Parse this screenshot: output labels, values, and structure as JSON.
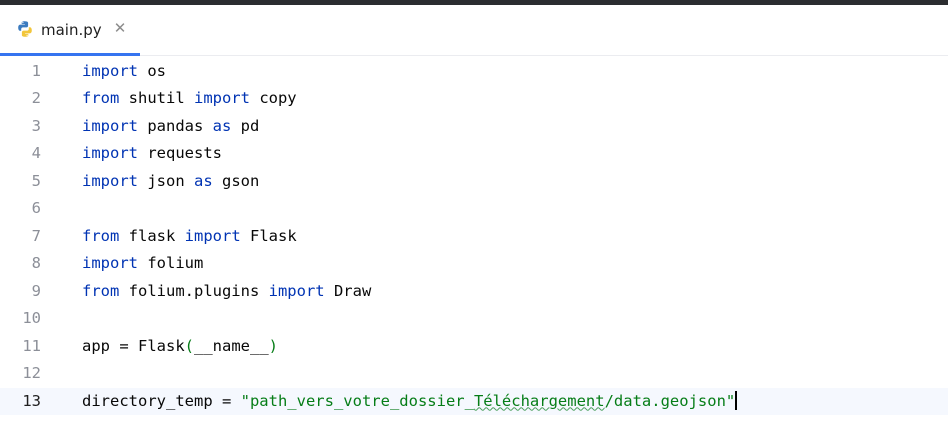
{
  "tab": {
    "label": "main.py",
    "close_glyph": "✕",
    "icon": "python-file-icon"
  },
  "colors": {
    "keyword": "#0033b3",
    "string": "#067d17",
    "tab_underline": "#3574f0",
    "current_line": "#f5f8fe"
  },
  "editor": {
    "current_line": 13,
    "lines": [
      {
        "num": "1",
        "tokens": [
          [
            "kw",
            "import"
          ],
          [
            "t",
            " os"
          ]
        ]
      },
      {
        "num": "2",
        "tokens": [
          [
            "kw",
            "from"
          ],
          [
            "t",
            " shutil "
          ],
          [
            "kw",
            "import"
          ],
          [
            "t",
            " copy"
          ]
        ]
      },
      {
        "num": "3",
        "tokens": [
          [
            "kw",
            "import"
          ],
          [
            "t",
            " pandas "
          ],
          [
            "kw",
            "as"
          ],
          [
            "t",
            " pd"
          ]
        ]
      },
      {
        "num": "4",
        "tokens": [
          [
            "kw",
            "import"
          ],
          [
            "t",
            " requests"
          ]
        ]
      },
      {
        "num": "5",
        "tokens": [
          [
            "kw",
            "import"
          ],
          [
            "t",
            " json "
          ],
          [
            "kw",
            "as"
          ],
          [
            "t",
            " gson"
          ]
        ]
      },
      {
        "num": "6",
        "tokens": []
      },
      {
        "num": "7",
        "tokens": [
          [
            "kw",
            "from"
          ],
          [
            "t",
            " flask "
          ],
          [
            "kw",
            "import"
          ],
          [
            "t",
            " Flask"
          ]
        ]
      },
      {
        "num": "8",
        "tokens": [
          [
            "kw",
            "import"
          ],
          [
            "t",
            " folium"
          ]
        ]
      },
      {
        "num": "9",
        "tokens": [
          [
            "kw",
            "from"
          ],
          [
            "t",
            " folium.plugins "
          ],
          [
            "kw",
            "import"
          ],
          [
            "t",
            " Draw"
          ]
        ]
      },
      {
        "num": "10",
        "tokens": []
      },
      {
        "num": "11",
        "tokens": [
          [
            "t",
            "app = Flask"
          ],
          [
            "str",
            "("
          ],
          [
            "t",
            "__name__"
          ],
          [
            "str",
            ")"
          ]
        ]
      },
      {
        "num": "12",
        "tokens": []
      },
      {
        "num": "13",
        "tokens": [
          [
            "t",
            "directory_temp = "
          ],
          [
            "str",
            "\"path_vers_votre_dossier_"
          ],
          [
            "warn",
            "Téléchargement"
          ],
          [
            "str",
            "/data.geojson\""
          ],
          [
            "caret",
            ""
          ]
        ]
      }
    ]
  }
}
